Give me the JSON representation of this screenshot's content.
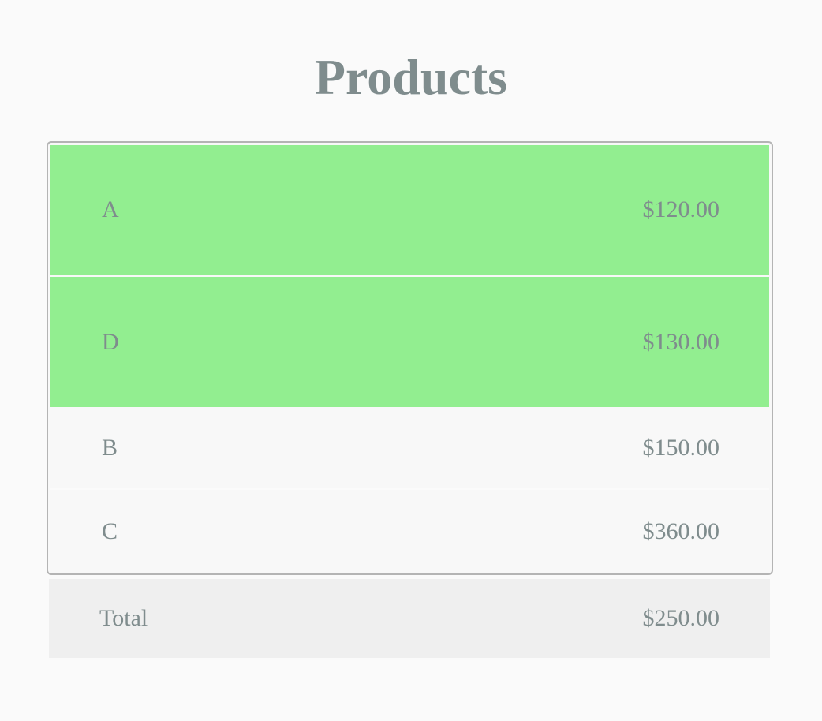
{
  "page": {
    "title": "Products"
  },
  "colors": {
    "title_text": "#7f8c8d",
    "selected_row": "#92ee90",
    "plain_row": "#f8f8f8",
    "total_bar": "#efefef",
    "table_border": "#b4b4b4"
  },
  "products": [
    {
      "name": "A",
      "price": "$120.00",
      "selected": true
    },
    {
      "name": "D",
      "price": "$130.00",
      "selected": true
    },
    {
      "name": "B",
      "price": "$150.00",
      "selected": false
    },
    {
      "name": "C",
      "price": "$360.00",
      "selected": false
    }
  ],
  "total": {
    "label": "Total",
    "value": "$250.00"
  }
}
